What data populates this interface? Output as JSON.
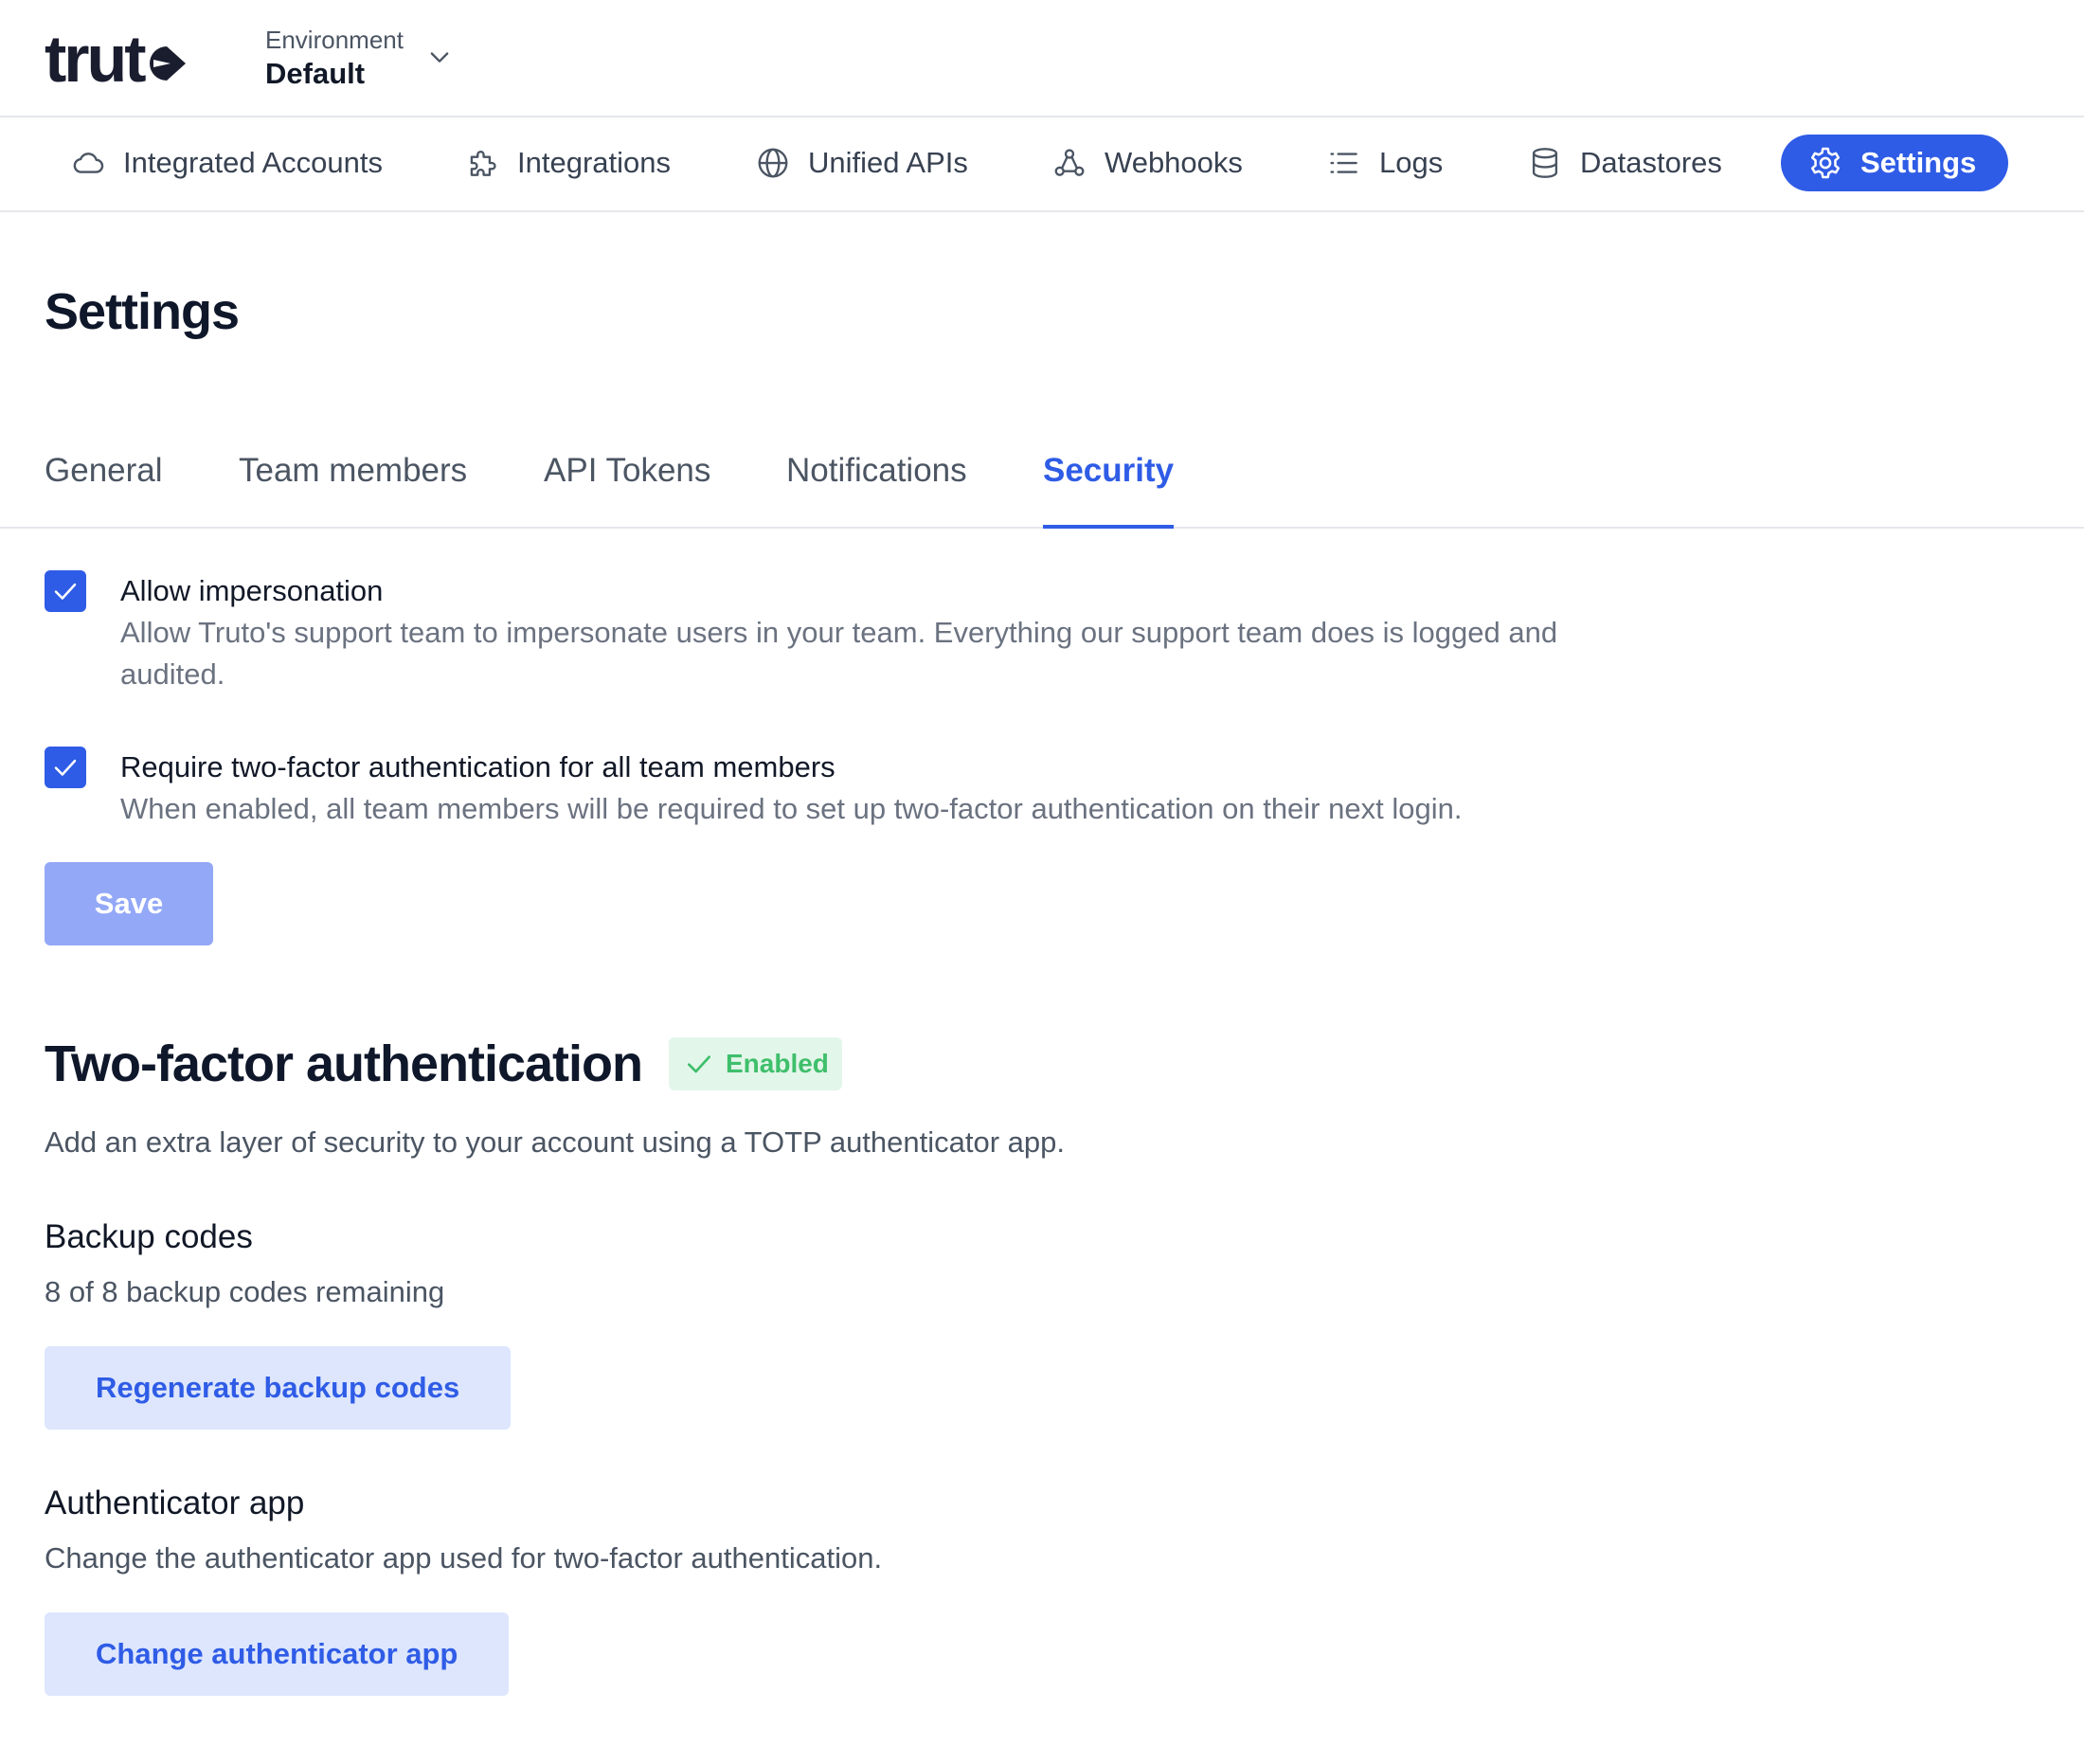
{
  "header": {
    "logo_text": "trut",
    "environment_label": "Environment",
    "environment_value": "Default"
  },
  "nav": {
    "items": [
      {
        "label": "Integrated Accounts",
        "icon": "cloud-icon"
      },
      {
        "label": "Integrations",
        "icon": "puzzle-icon"
      },
      {
        "label": "Unified APIs",
        "icon": "globe-icon"
      },
      {
        "label": "Webhooks",
        "icon": "webhook-icon"
      },
      {
        "label": "Logs",
        "icon": "list-icon"
      },
      {
        "label": "Datastores",
        "icon": "database-icon"
      },
      {
        "label": "Settings",
        "icon": "gear-icon",
        "active": true
      }
    ]
  },
  "page": {
    "title": "Settings"
  },
  "tabs": [
    {
      "label": "General"
    },
    {
      "label": "Team members"
    },
    {
      "label": "API Tokens"
    },
    {
      "label": "Notifications"
    },
    {
      "label": "Security",
      "active": true
    }
  ],
  "security": {
    "options": [
      {
        "title": "Allow impersonation",
        "description": "Allow Truto's support team to impersonate users in your team. Everything our support team does is logged and audited.",
        "checked": true
      },
      {
        "title": "Require two-factor authentication for all team members",
        "description": "When enabled, all team members will be required to set up two-factor authentication on their next login.",
        "checked": true
      }
    ],
    "save_label": "Save"
  },
  "two_factor": {
    "title": "Two-factor authentication",
    "status_badge": "Enabled",
    "description": "Add an extra layer of security to your account using a TOTP authenticator app.",
    "backup_codes": {
      "title": "Backup codes",
      "status": "8 of 8 backup codes remaining",
      "button_label": "Regenerate backup codes"
    },
    "authenticator_app": {
      "title": "Authenticator app",
      "description": "Change the authenticator app used for two-factor authentication.",
      "button_label": "Change authenticator app"
    }
  },
  "colors": {
    "accent": "#2f5ce6",
    "accent_light": "#dde6fd",
    "save_disabled": "#93a8f7",
    "success_bg": "#e3f6ea",
    "success_text": "#3fbf6b"
  }
}
